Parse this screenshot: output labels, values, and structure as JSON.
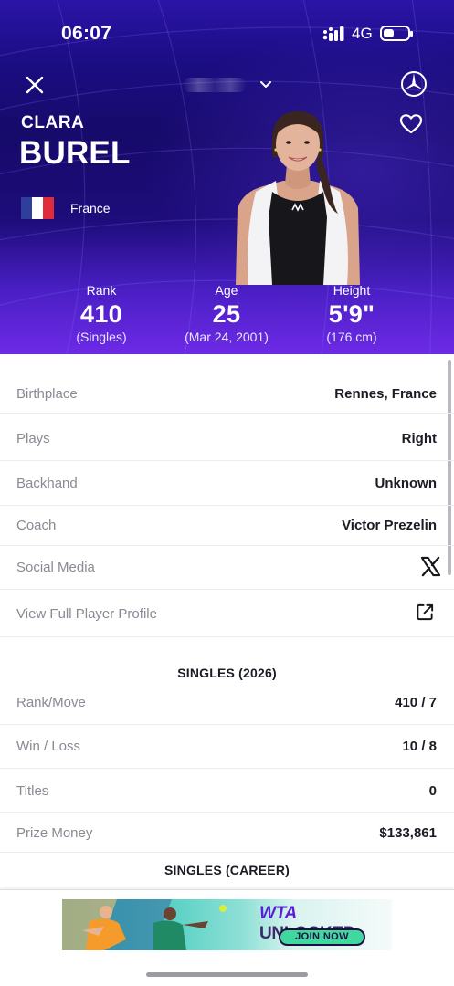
{
  "status_bar": {
    "time": "06:07",
    "network": "4G",
    "icons": [
      "signal-icon",
      "battery-icon"
    ]
  },
  "header": {
    "icons": [
      "close-icon",
      "chevron-down-icon",
      "mercedes-logo",
      "heart-icon"
    ]
  },
  "player": {
    "first_name": "CLARA",
    "last_name": "BUREL",
    "country": "France",
    "flag_colors": [
      "#2d3f9b",
      "#ffffff",
      "#e02b3c"
    ]
  },
  "stats": [
    {
      "label": "Rank",
      "value": "410",
      "sub": "(Singles)"
    },
    {
      "label": "Age",
      "value": "25",
      "sub": "(Mar 24, 2001)"
    },
    {
      "label": "Height",
      "value": "5'9\"",
      "sub": "(176 cm)"
    }
  ],
  "bio": [
    {
      "key": "Birthplace",
      "value": "Rennes, France"
    },
    {
      "key": "Plays",
      "value": "Right"
    },
    {
      "key": "Backhand",
      "value": "Unknown"
    },
    {
      "key": "Coach",
      "value": "Victor Prezelin"
    },
    {
      "key": "Social Media",
      "icon": "x-logo-icon"
    },
    {
      "key": "View Full Player Profile",
      "icon": "external-link-icon"
    }
  ],
  "singles_2026": {
    "title": "SINGLES (2026)",
    "rows": [
      {
        "key": "Rank/Move",
        "value": "410 / 7"
      },
      {
        "key": "Win / Loss",
        "value": "10 / 8"
      },
      {
        "key": "Titles",
        "value": "0"
      },
      {
        "key": "Prize Money",
        "value": "$133,861"
      }
    ]
  },
  "singles_career": {
    "title": "SINGLES (CAREER)"
  },
  "ad_banner": {
    "title_a": "WTA",
    "title_b": " UNLOCKED",
    "button": "JOIN NOW"
  },
  "colors": {
    "hero_top": "#1b0d82",
    "hero_bottom": "#6d2ae6",
    "banner_teal": "#2fc3b9",
    "banner_button": "#3fd9a0"
  }
}
